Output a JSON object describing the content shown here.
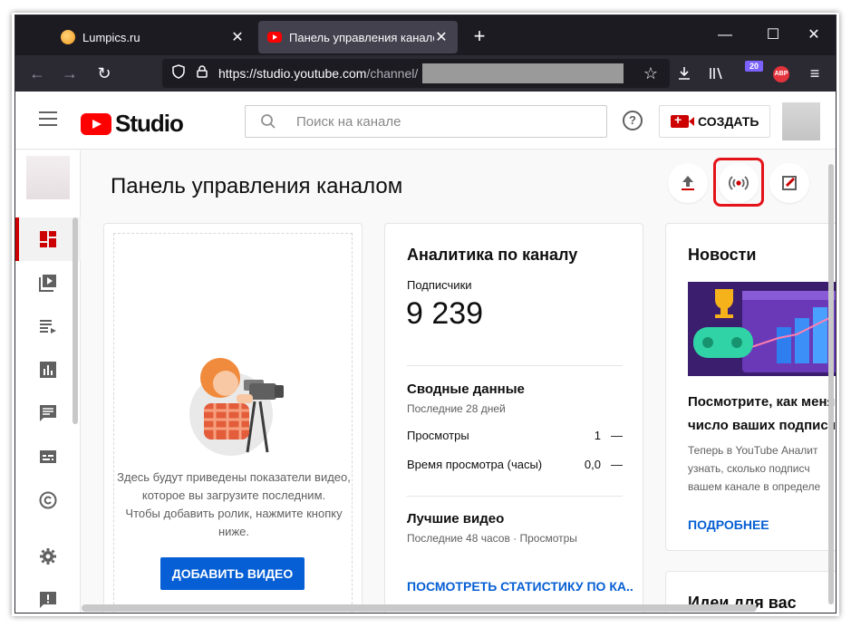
{
  "browser": {
    "tabs": [
      {
        "title": "Lumpics.ru",
        "favicon": "lumpics-icon"
      },
      {
        "title": "Панель управления каналом",
        "favicon": "youtube-icon",
        "active": true
      }
    ],
    "new_tab": "+",
    "window_controls": {
      "minimize": "—",
      "maximize": "☐",
      "close": "✕"
    },
    "url_host": "https://studio.youtube.com",
    "url_path": "/channel/",
    "extension_badge": "20",
    "adblock_label": "ABP"
  },
  "header": {
    "logo_text": "Studio",
    "search_placeholder": "Поиск на канале",
    "help_icon": "?",
    "create_label": "СОЗДАТЬ"
  },
  "sidebar": {
    "items": [
      {
        "name": "dashboard",
        "active": true
      },
      {
        "name": "content"
      },
      {
        "name": "playlists"
      },
      {
        "name": "analytics"
      },
      {
        "name": "comments"
      },
      {
        "name": "subtitles"
      },
      {
        "name": "copyright"
      },
      {
        "name": "settings"
      },
      {
        "name": "feedback"
      }
    ]
  },
  "main": {
    "page_title": "Панель управления каналом",
    "upload_card": {
      "text_lines": [
        "Здесь будут приведены показатели видео,",
        "которое вы загрузите последним.",
        "Чтобы добавить ролик, нажмите кнопку",
        "ниже."
      ],
      "button": "ДОБАВИТЬ ВИДЕО"
    },
    "analytics_card": {
      "title": "Аналитика по каналу",
      "subscribers_label": "Подписчики",
      "subscribers_value": "9 239",
      "summary_title": "Сводные данные",
      "summary_period": "Последние 28 дней",
      "rows": [
        {
          "label": "Просмотры",
          "value": "1",
          "delta": "—"
        },
        {
          "label": "Время просмотра (часы)",
          "value": "0,0",
          "delta": "—"
        }
      ],
      "top_videos_title": "Лучшие видео",
      "top_videos_period": "Последние 48 часов · Просмотры",
      "link": "ПОСМОТРЕТЬ СТАТИСТИКУ ПО КА..."
    },
    "news_card": {
      "title": "Новости",
      "headline_lines": [
        "Посмотрите, как меня",
        "число ваших подписч"
      ],
      "body_lines": [
        "Теперь в YouTube Аналит",
        "узнать, сколько подписч",
        "вашем канале в определе"
      ],
      "link": "ПОДРОБНЕЕ"
    },
    "ideas_card": {
      "title": "Идеи для вас"
    }
  },
  "colors": {
    "accent_red": "#cc0000",
    "highlight_red": "#e4131a",
    "link_blue": "#065fd4",
    "browser_dark": "#1c1b22"
  }
}
